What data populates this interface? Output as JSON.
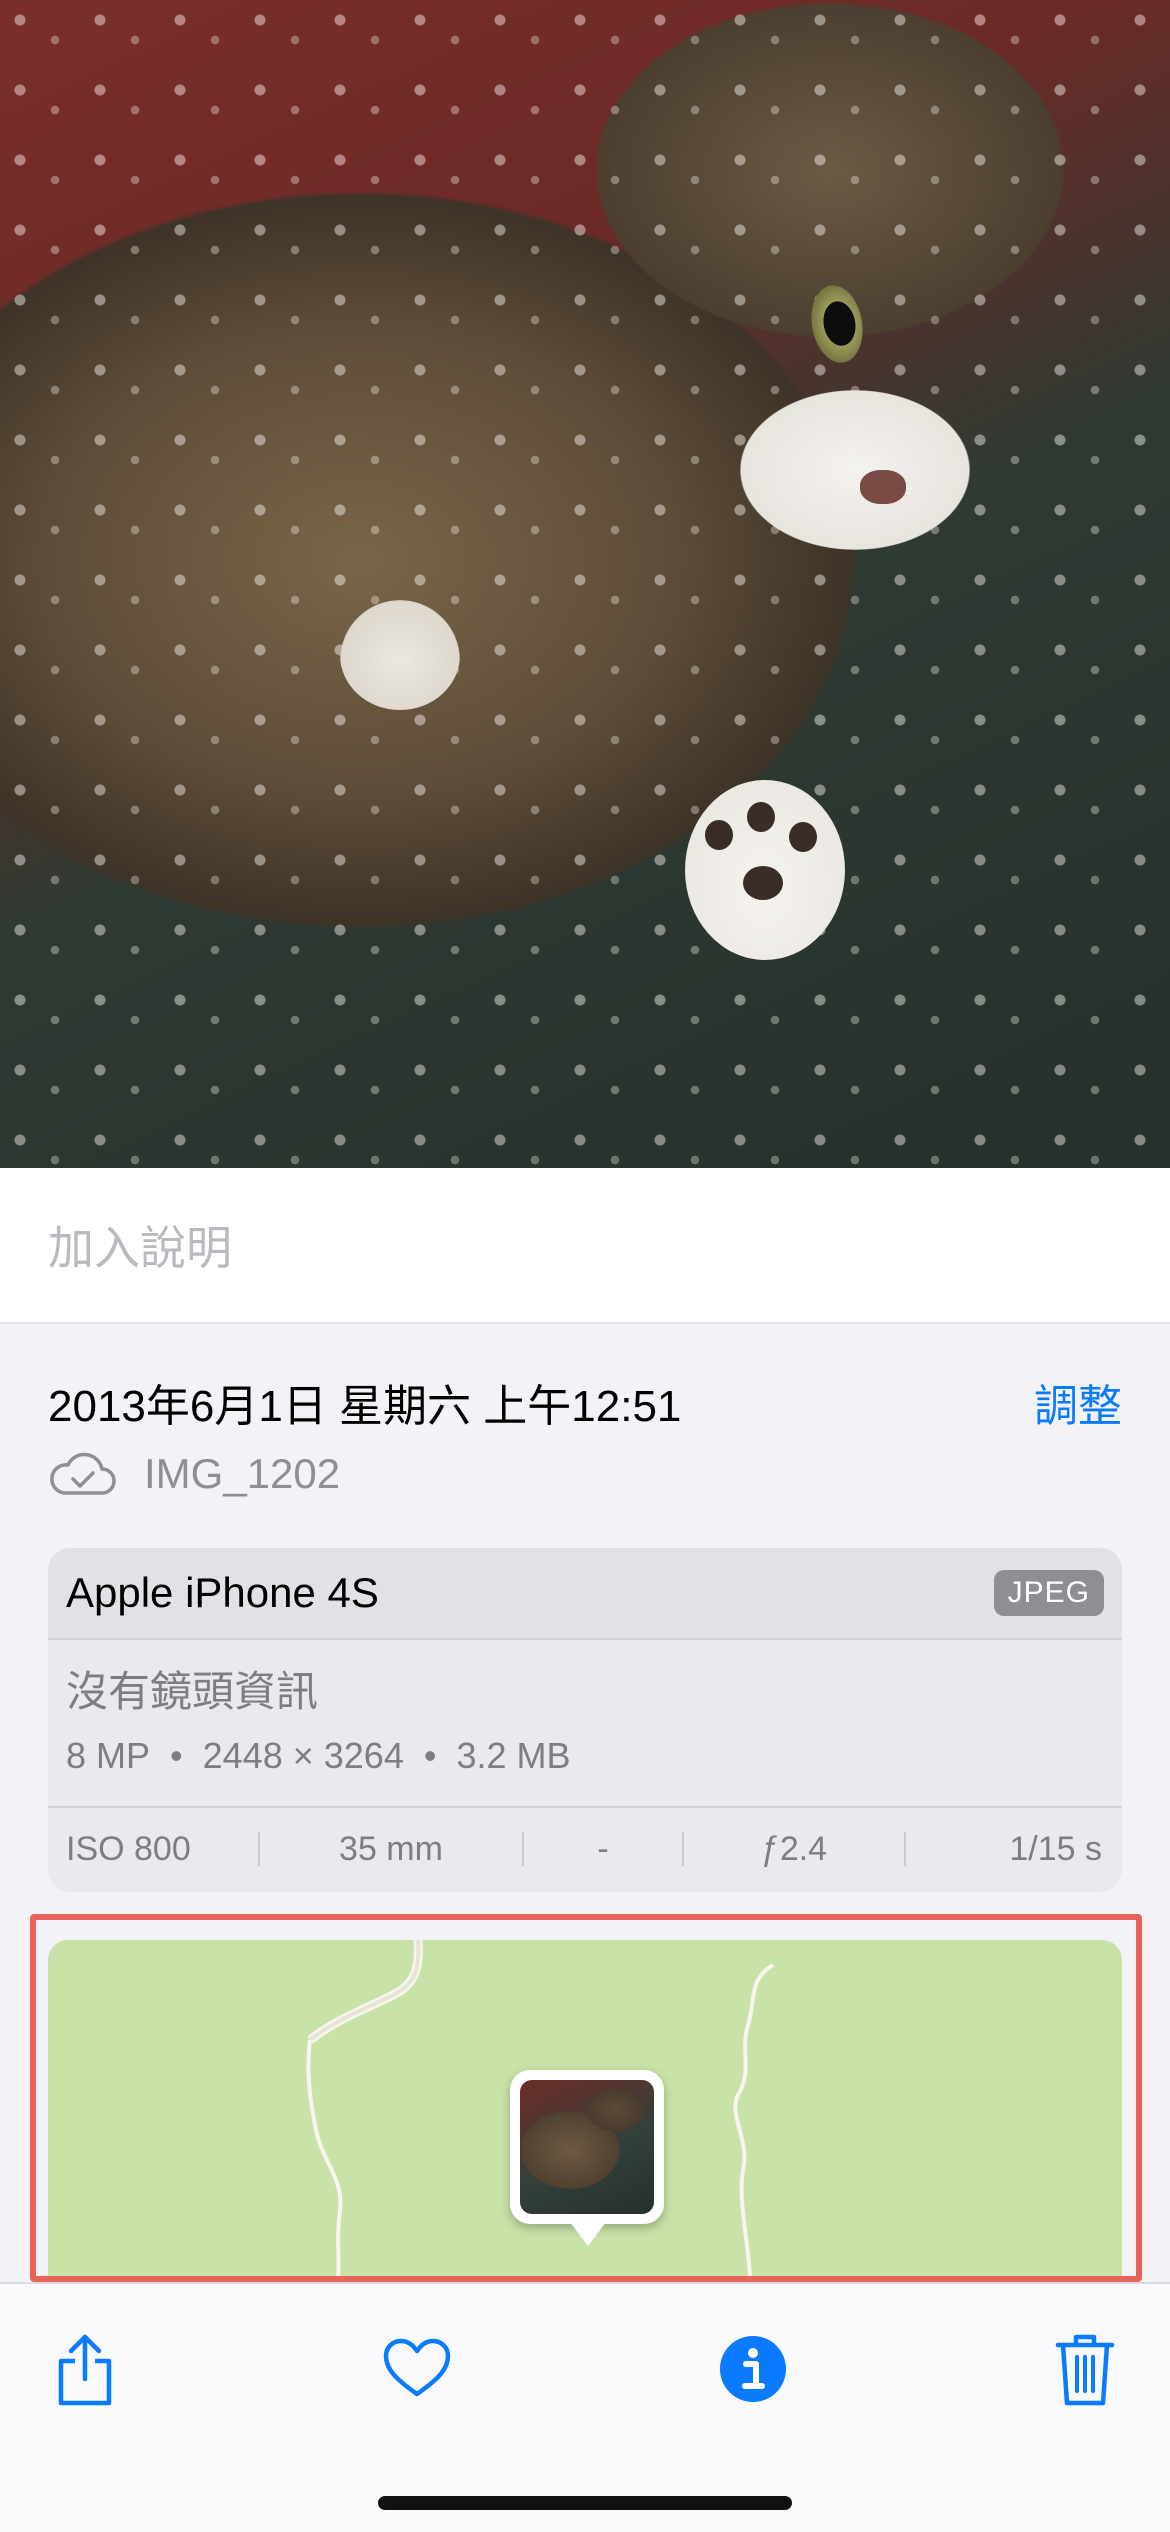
{
  "caption": {
    "placeholder": "加入說明"
  },
  "photo_info": {
    "datetime": "2013年6月1日 星期六 上午12:51",
    "adjust_label": "調整",
    "filename": "IMG_1202"
  },
  "camera": {
    "device": "Apple iPhone 4S",
    "format": "JPEG",
    "lens": "沒有鏡頭資訊",
    "megapixels": "8 MP",
    "resolution": "2448 × 3264",
    "file_size": "3.2 MB",
    "separator": "•",
    "exif": {
      "iso": "ISO 800",
      "focal_length": "35 mm",
      "exposure_bias": "-",
      "aperture": "ƒ2.4",
      "shutter": "1/15 s"
    }
  },
  "toolbar": {
    "icons": [
      "share-icon",
      "heart-icon",
      "info-icon",
      "trash-icon"
    ]
  },
  "colors": {
    "accent": "#0a7aff",
    "map_land": "#c8e2a7",
    "highlight_border": "#e8645a"
  }
}
